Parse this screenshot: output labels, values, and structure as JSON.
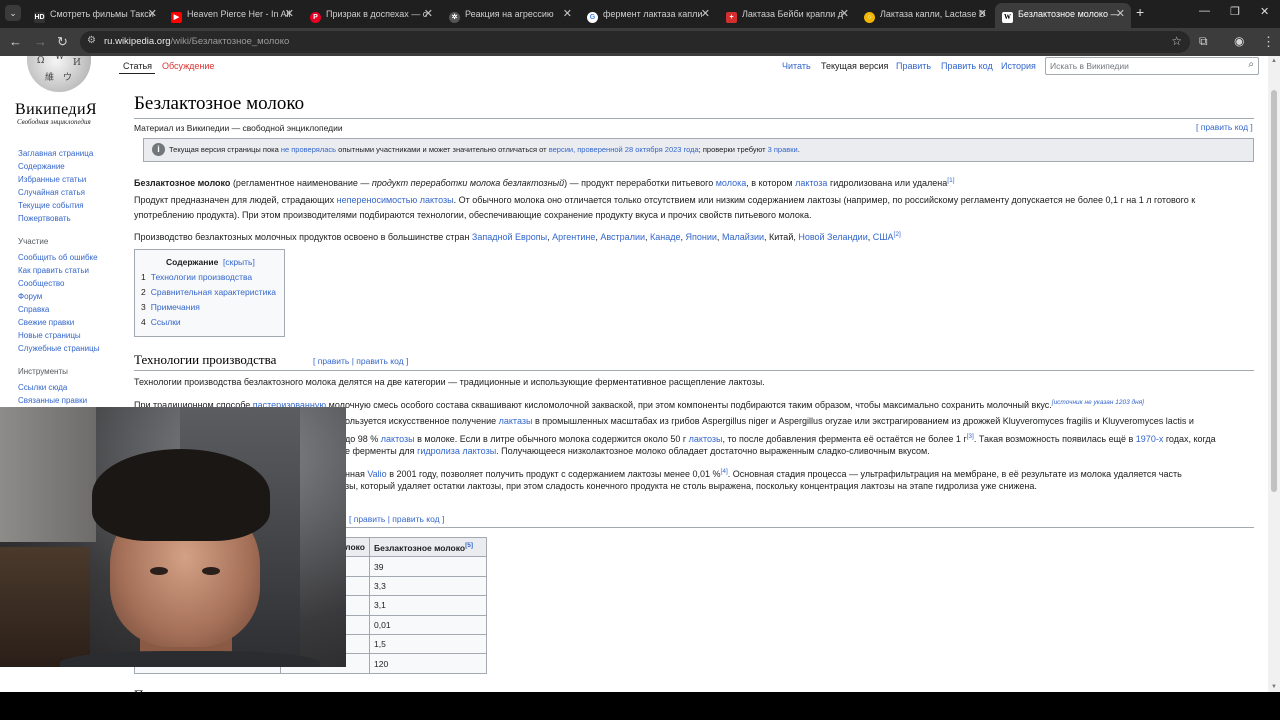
{
  "browser": {
    "tabs": [
      {
        "title": "Смотреть фильмы Такси",
        "icon": "hd-favicon",
        "icon_text": "HD",
        "color": "#333333"
      },
      {
        "title": "Heaven Pierce Her - In All",
        "icon": "youtube-favicon",
        "icon_text": "▶",
        "color": "#ff0000"
      },
      {
        "title": "Призрак в доспехах — с",
        "icon": "pinterest-favicon",
        "icon_text": "P",
        "color": "#e60023"
      },
      {
        "title": "Реакция на агрессию",
        "icon": "chatgpt-favicon",
        "icon_text": "✲",
        "color": "#555555"
      },
      {
        "title": "фермент лактаза капли",
        "icon": "google-favicon",
        "icon_text": "G",
        "color": "#4285f4"
      },
      {
        "title": "Лактаза Бейби крапли д",
        "icon": "pharmacy-favicon",
        "icon_text": "+",
        "color": "#d32f2f"
      },
      {
        "title": "Лактаза капли, Lactase D",
        "icon": "shop-favicon",
        "icon_text": "○",
        "color": "#f2b705"
      },
      {
        "title": "Безлактозное молоко —",
        "icon": "wikipedia-favicon",
        "icon_text": "W",
        "color": "#ffffff",
        "active": true
      }
    ],
    "url_host": "ru.wikipedia.org",
    "url_path": "/wiki/Безлактозное_молоко"
  },
  "sidebar": {
    "wordmark": "ВикипедиЯ",
    "tagline": "Свободная энциклопедия",
    "main_links": [
      "Заглавная страница",
      "Содержание",
      "Избранные статьи",
      "Случайная статья",
      "Текущие события",
      "Пожертвовать"
    ],
    "participation_heading": "Участие",
    "participation_links": [
      "Сообщить об ошибке",
      "Как править статьи",
      "Сообщество",
      "Форум",
      "Справка",
      "Свежие правки",
      "Новые страницы",
      "Служебные страницы"
    ],
    "tools_heading": "Инструменты",
    "tools_links": [
      "Ссылки сюда",
      "Связанные правки"
    ]
  },
  "page_tabs": {
    "article": "Статья",
    "talk": "Обсуждение",
    "read": "Читать",
    "current": "Текущая версия",
    "edit": "Править",
    "edit_code": "Править код",
    "history": "История"
  },
  "search": {
    "placeholder": "Искать в Википедии"
  },
  "article": {
    "title": "Безлактозное молоко",
    "from": "Материал из Википедии — свободной энциклопедии",
    "edit_code": "[ править код ]",
    "notice_pre": "Текущая версия страницы пока ",
    "notice_link1": "не проверялась",
    "notice_mid": " опытными участниками и может значительно отличаться от ",
    "notice_link2": "версии, проверенной 28 октября 2023 года",
    "notice_mid2": "; проверки требуют ",
    "notice_link3": "3 правки",
    "notice_end": ".",
    "p1_bold": "Безлактозное молоко",
    "p1_a": " (регламентное наименование — ",
    "p1_italic": "продукт переработки молока безлактозный",
    "p1_b": ") — продукт переработки питьевого ",
    "p1_link1": "молока",
    "p1_c": ", в котором ",
    "p1_link2": "лактоза",
    "p1_d": " гидролизована или удалена",
    "p1_sup": "[1]",
    "p2_a": "Продукт предназначен для людей, страдающих ",
    "p2_link": "непереносимостью лактозы",
    "p2_b": ". От обычного молока оно отличается только отсутствием или низким содержанием лактозы (например, по российскому регламенту допускается не более 0,1 г на 1 л готового к употреблению продукта). При этом производителями подбираются технологии, обеспечивающие сохранение продукту вкуса и прочих свойств питьевого молока.",
    "p3_a": "Производство безлактозных молочных продуктов освоено в большинстве стран ",
    "p3_links": [
      "Западной Европы",
      "Аргентине",
      "Австралии",
      "Канаде",
      "Японии",
      "Малайзии"
    ],
    "p3_b": ", Китай, ",
    "p3_link_nz": "Новой Зеландии",
    "p3_c": ", ",
    "p3_link_usa": "США",
    "p3_sup": "[2]",
    "toc_title": "Содержание",
    "toc_hide": "[скрыть]",
    "toc": [
      {
        "num": "1",
        "text": "Технологии производства"
      },
      {
        "num": "2",
        "text": "Сравнительная характеристика"
      },
      {
        "num": "3",
        "text": "Примечания"
      },
      {
        "num": "4",
        "text": "Ссылки"
      }
    ],
    "h2_tech": "Технологии производства",
    "h2_edit": "[ править | править код ]",
    "t1": "Технологии производства безлактозного молока делятся на две категории — традиционные и использующие ферментативное расщепление лактозы.",
    "t2_a": "При традиционном способе ",
    "t2_link": "пастеризованную",
    "t2_b": " молочную смесь особого состава сквашивают кисломолочной закваской, при этом компоненты подбираются таким образом, чтобы максимально сохранить молочный вкус.",
    "t2_sup": "[источник не указан 1203 дня]",
    "t3_a": "ользуется искусственное получение ",
    "t3_link": "лактазы",
    "t3_b": " в промышленных масштабах из грибов Aspergillus niger и Aspergillus oryzae или экстрагированием из дрожжей Kluyveromyces fragilis и Kluyveromyces lactis и",
    "t4_a": "до 98 % ",
    "t4_link": "лактозы",
    "t4_b": " в молоке. Если в литре обычного молока содержится около 50 г ",
    "t4_link2": "лактозы",
    "t4_c": ", то после добавления фермента её остаётся не более 1 г",
    "t4_sup": "[3]",
    "t4_d": ". Такая возможность появилась ещё в ",
    "t4_link3": "1970-х",
    "t4_e": " годах, когда",
    "t5_a": "е ферменты для ",
    "t5_link": "гидролиза лактозы",
    "t5_b": ". Получающееся низколактозное молоко обладает достаточно выраженным сладко-сливочным вкусом.",
    "t6_a": "нная ",
    "t6_link": "Valio",
    "t6_b": " в 2001 году, позволяет получить продукт с содержанием лактозы менее 0,01 %",
    "t6_sup": "[4]",
    "t6_c": ". Основная стадия процесса — ультрафильтрация на мембране, в её результате из молока удаляется часть",
    "t7": "зы, который удаляет остатки лактозы, при этом сладость конечного продукта не столь выражена, поскольку концентрация лактозы на этапе гидролиза уже снижена.",
    "h2_edit2": "[ править | править код ]",
    "table_head_partial": "локо",
    "table_head": "Безлактозное молоко",
    "table_head_sup": "[5]",
    "table_values": [
      "39",
      "3,3",
      "3,1",
      "0,01",
      "1,5",
      "120"
    ],
    "next_heading_partial": "П"
  }
}
